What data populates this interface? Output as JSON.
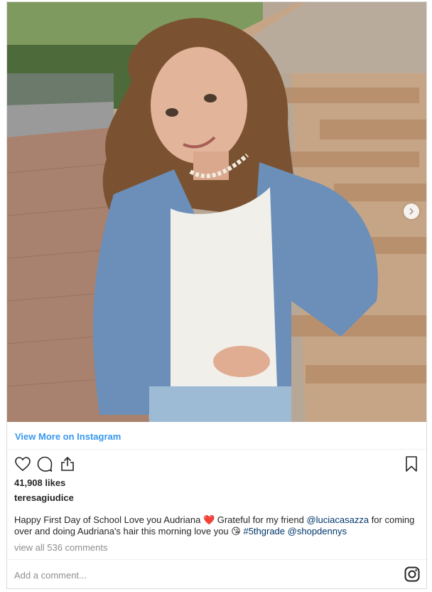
{
  "post": {
    "photo": {
      "alt_icon": "photo-of-girl-in-denim-jacket",
      "next_icon": "chevron-right-icon"
    },
    "view_more": "View More on Instagram",
    "actions": {
      "like_icon": "heart-icon",
      "comment_icon": "comment-icon",
      "share_icon": "share-icon",
      "save_icon": "bookmark-icon"
    },
    "likes": "41,908 likes",
    "username": "teresagiudice",
    "caption": {
      "part1": "Happy First Day of School Love you Audriana ",
      "emoji1": "❤️",
      "part2": " Grateful for my friend ",
      "mention1": "@luciacasazza",
      "part3": " for coming over and doing Audriana's hair this morning love you ",
      "emoji2": "😘",
      "part4": " ",
      "hashtag": "#5thgrade",
      "part5": " ",
      "mention2": "@shopdennys"
    },
    "comments_link": "view all 536 comments",
    "add_comment_placeholder": "Add a comment...",
    "instagram_icon": "instagram-icon",
    "colors": {
      "link_blue": "#3897f0",
      "mention_navy": "#003569",
      "muted": "#8e8e8e",
      "border": "#dbdbdb"
    }
  }
}
